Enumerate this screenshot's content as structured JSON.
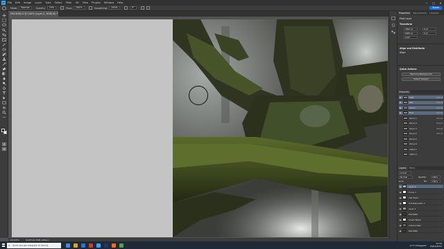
{
  "app": {
    "logo": "Ps"
  },
  "menubar": {
    "items": [
      "File",
      "Edit",
      "Image",
      "Layer",
      "Type",
      "Select",
      "Filter",
      "3D",
      "View",
      "Plugins",
      "Window",
      "Help"
    ],
    "window_controls": [
      "—",
      "□",
      "✕"
    ]
  },
  "options_bar": {
    "mode_label": "Mode:",
    "mode_value": "Normal",
    "opacity_label": "Opacity:",
    "opacity_value": "25%",
    "flow_label": "Flow:",
    "flow_value": "100%",
    "smoothing_label": "Smoothing:",
    "smoothing_value": "100%",
    "angle_value": "0°",
    "share_label": "Share"
  },
  "document": {
    "tab_title": "DSC3085-3 @ 100% (Layer 0, RGB/16) *"
  },
  "status_bar": {
    "zoom": "100,00%",
    "profile": "ProPhoto RGB (16bpc)"
  },
  "properties_panel": {
    "tabs": [
      "Properties",
      "Adjustments",
      "Libraries"
    ],
    "layer_type": "Pixel Layer",
    "transform_title": "Transform",
    "w_value": "4000 px",
    "h_value": "6000 px",
    "x_value": "0 px",
    "y_value": "0 px",
    "angle_value": "0,00°",
    "align_title": "Align and Distribute",
    "align_sub": "Align:",
    "quick_actions_title": "Quick Actions",
    "remove_bg": "Remove Background",
    "select_subject": "Select Subject"
  },
  "channels_panel": {
    "tab": "Channels",
    "rows": [
      {
        "name": "RGB",
        "shortcut": "Ctrl+2",
        "visible": true,
        "selected": true
      },
      {
        "name": "Red",
        "shortcut": "Ctrl+3",
        "visible": true,
        "selected": true
      },
      {
        "name": "Green",
        "shortcut": "Ctrl+4",
        "visible": true,
        "selected": true
      },
      {
        "name": "Blue",
        "shortcut": "Ctrl+5",
        "visible": true,
        "selected": true
      },
      {
        "name": "Zeros 1",
        "shortcut": "Ctrl+6",
        "visible": false,
        "selected": false
      },
      {
        "name": "Zeros 2",
        "shortcut": "Ctrl+7",
        "visible": false,
        "selected": false
      },
      {
        "name": "Zeros 3",
        "shortcut": "Ctrl+8",
        "visible": false,
        "selected": false
      },
      {
        "name": "Zeros 4",
        "shortcut": "Ctrl+9",
        "visible": false,
        "selected": false
      },
      {
        "name": "Zeros 5",
        "shortcut": "",
        "visible": false,
        "selected": false
      },
      {
        "name": "Zeros 6",
        "shortcut": "",
        "visible": false,
        "selected": false
      },
      {
        "name": "Alpha 1",
        "shortcut": "",
        "visible": false,
        "selected": false
      },
      {
        "name": "Alpha 2",
        "shortcut": "",
        "visible": false,
        "selected": false
      }
    ]
  },
  "layers_panel": {
    "tabs": [
      "Layers",
      "Paths"
    ],
    "kind_label": "Q Kind",
    "blend_mode": "Normal",
    "opacity_label": "Opacity:",
    "opacity_value": "100%",
    "lock_label": "Lock:",
    "fill_label": "Fill:",
    "fill_value": "100%",
    "rows": [
      {
        "name": "Layer 0",
        "selected": true,
        "thumb": "#b0b0b0"
      },
      {
        "name": "Curve 1",
        "selected": false,
        "thumb": "#ffffff"
      },
      {
        "name": "Clip Highl.",
        "selected": false,
        "thumb": "#ffffff"
      },
      {
        "name": "Hue/Saturation 1",
        "selected": false,
        "thumb": "#ffffff"
      },
      {
        "name": "Layer 1",
        "selected": false,
        "thumb": "#9a9a9a"
      },
      {
        "name": "DSC3085",
        "selected": false,
        "thumb": "#3a3a2a"
      },
      {
        "name": "Smart Filters",
        "selected": false,
        "thumb": "#ffffff"
      },
      {
        "name": "Camera Raw",
        "selected": false,
        "thumb": "#666"
      },
      {
        "name": "DSC3085",
        "selected": false,
        "thumb": "#3a3a2a"
      }
    ]
  },
  "taskbar": {
    "search_placeholder": "Scrivi qui per eseguire la ricerca",
    "weather": "11°C  Soleggiato",
    "time": "15:34",
    "date": "23/01/2022",
    "app_colors": [
      "#3d8de0",
      "#e0a02a",
      "#2f6fd0",
      "#d23a2a",
      "#31a8ff",
      "#1b3a6b",
      "#ff6b00",
      "#4aa84a"
    ]
  },
  "colors": {
    "accent": "#1473e6",
    "ps_blue": "#31a8ff",
    "panel_bg": "#3c3c3c",
    "workspace": "#535353"
  }
}
